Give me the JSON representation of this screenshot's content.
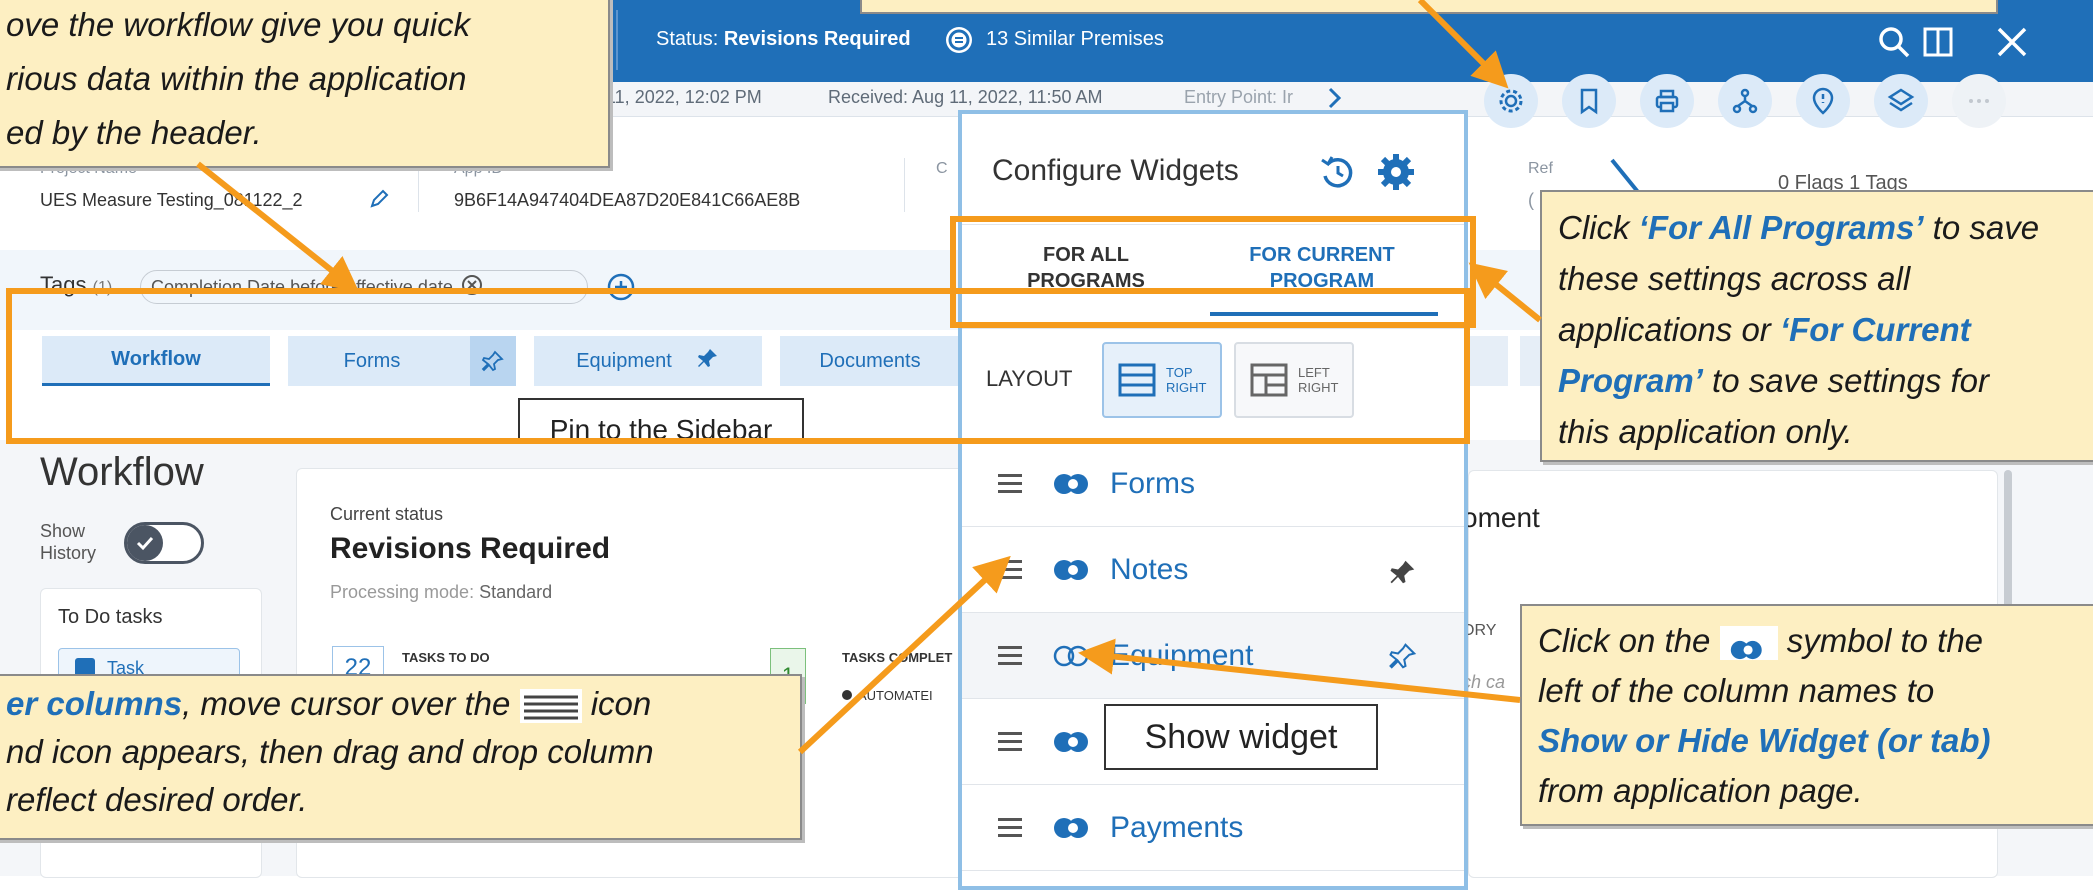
{
  "header": {
    "status_label": "Status:",
    "status_value": "Revisions Required",
    "similar": "13 Similar Premises",
    "sub_date": "11, 2022, 12:02 PM",
    "received": "Received: Aug 11, 2022, 11:50 AM",
    "entry_point": "Entry Point: Ir"
  },
  "info": {
    "project_label": "Project Name",
    "project_value": "UES Measure Testing_081122_2",
    "app_label": "App ID",
    "app_value": "9B6F14A947404DEA87D20E841C66AE8B",
    "c_label": "C",
    "ref_label": "Ref",
    "ref_value": "(",
    "flags_text": "0 Flags  1 Tags"
  },
  "tags": {
    "label": "Tags",
    "count": "(1)",
    "chip": "Completion Date before effective date"
  },
  "tabs": [
    {
      "label": "Workflow"
    },
    {
      "label": "Forms"
    },
    {
      "label": "Equipment"
    },
    {
      "label": "Documents"
    }
  ],
  "pin_tooltip": "Pin to the Sidebar",
  "workflow": {
    "title": "Workflow",
    "show_history": "Show\nHistory",
    "todo": "To Do tasks",
    "task": "Task",
    "current_status_label": "Current status",
    "current_status": "Revisions Required",
    "processing_label": "Processing mode:",
    "processing_value": "Standard",
    "tasks_todo_label": "TASKS TO DO",
    "tasks_todo_count": "22",
    "tasks_complete_label": "TASKS COMPLET",
    "tasks_complete_count": "1",
    "automated": "AUTOMATEI"
  },
  "right_panel": {
    "title_fragment": "oment",
    "ory": "ORY",
    "search_fragment": "ch ca"
  },
  "popup": {
    "title": "Configure Widgets",
    "tab_all": "FOR ALL PROGRAMS",
    "tab_current": "FOR CURRENT PROGRAM",
    "layout_label": "LAYOUT",
    "layout_top": "TOP RIGHT",
    "layout_left": "LEFT RIGHT",
    "rows": [
      {
        "label": "Forms",
        "visible": true,
        "pin": ""
      },
      {
        "label": "Notes",
        "visible": true,
        "pin": "filled"
      },
      {
        "label": "Equipment",
        "visible": false,
        "pin": "outline"
      },
      {
        "label": "",
        "visible": true,
        "pin": ""
      },
      {
        "label": "Payments",
        "visible": true,
        "pin": ""
      }
    ],
    "show_widget_tooltip": "Show widget"
  },
  "callouts": {
    "top_left": [
      "ove the workflow give you quick",
      "rious data within the application",
      "ed by the header."
    ],
    "right_top_1": "Click ",
    "right_top_b1": "‘For All Programs’",
    "right_top_2": " to save",
    "right_top_3": "these settings across all",
    "right_top_4": "applications or ",
    "right_top_b2": "‘For Current",
    "right_top_b3": "Program’",
    "right_top_5": " to save settings for",
    "right_top_6": "this application only.",
    "right_bot_1": "Click on the ",
    "right_bot_2": " symbol to the",
    "right_bot_3": "left of the column names to",
    "right_bot_b": "Show or Hide Widget (or tab)",
    "right_bot_4": "from application page.",
    "bot_left_b": "er columns",
    "bot_left_1": ", move cursor over the ",
    "bot_left_2": " icon",
    "bot_left_3": "nd icon appears, then drag and drop column",
    "bot_left_4": "reflect desired order."
  },
  "colors": {
    "brand": "#1f6fb8",
    "accent": "#f59b1c",
    "callout": "#fdefc2"
  }
}
